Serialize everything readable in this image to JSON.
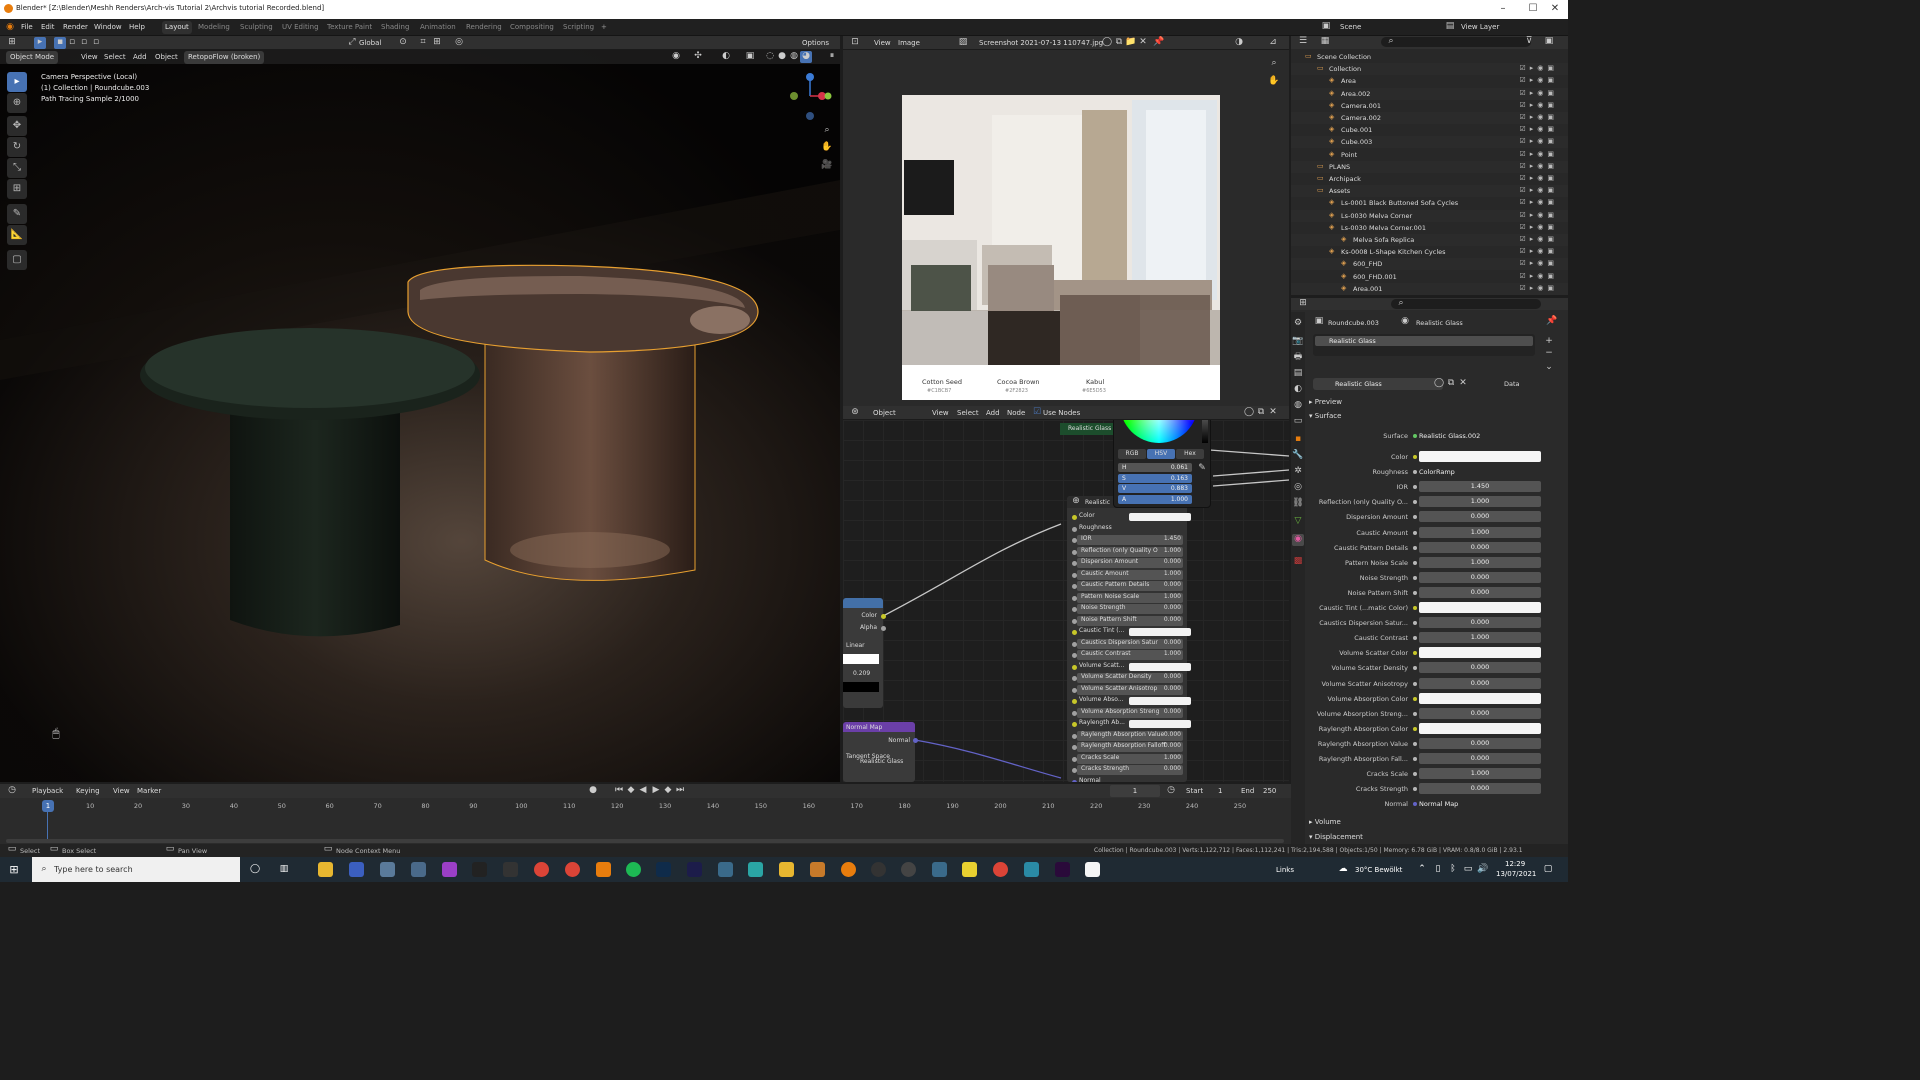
{
  "window": {
    "title": "Blender* [Z:\\Blender\\Meshh Renders\\Arch-vis Tutorial 2\\Archvis tutorial Recorded.blend]"
  },
  "menu": {
    "items": [
      "File",
      "Edit",
      "Render",
      "Window",
      "Help"
    ]
  },
  "workspaces": [
    "Layout",
    "Modeling",
    "Sculpting",
    "UV Editing",
    "Texture Paint",
    "Shading",
    "Animation",
    "Rendering",
    "Compositing",
    "Scripting"
  ],
  "scene": {
    "label": "Scene",
    "view_layer": "View Layer"
  },
  "viewport": {
    "mode": "Object Mode",
    "menus": [
      "View",
      "Select",
      "Add",
      "Object"
    ],
    "addon": "RetopoFlow (broken)",
    "transform": "Global",
    "options": "Options",
    "overlay_lines": [
      "Camera Perspective (Local)",
      "(1) Collection | Roundcube.003",
      "Path Tracing Sample 2/1000"
    ]
  },
  "image_editor": {
    "menus": [
      "View",
      "Image"
    ],
    "image_name": "Screenshot 2021-07-13 110747.jpg",
    "swatches": [
      {
        "name": "Cotton Seed",
        "code": "#C1BCB7",
        "color": "#c1bcb7"
      },
      {
        "name": "Cocoa Brown",
        "code": "#2F2823",
        "color": "#2f2823"
      },
      {
        "name": "Kabul",
        "code": "#6E5D53",
        "color": "#6e5d53"
      }
    ]
  },
  "color_picker": {
    "tabs": [
      "RGB",
      "HSV",
      "Hex"
    ],
    "active_tab": "HSV",
    "fields": [
      {
        "label": "H",
        "value": "0.061"
      },
      {
        "label": "S",
        "value": "0.163"
      },
      {
        "label": "V",
        "value": "0.883"
      },
      {
        "label": "A",
        "value": "1.000"
      }
    ]
  },
  "node_editor": {
    "object_mode": "Object",
    "menus": [
      "View",
      "Select",
      "Add",
      "Node"
    ],
    "use_nodes": "Use Nodes",
    "group_frame_label": "Realistic Glass",
    "group_node_label": "Realistic",
    "rows": [
      {
        "label": "Color",
        "value": ""
      },
      {
        "label": "Roughness",
        "value": ""
      },
      {
        "label": "IOR",
        "value": "1.450"
      },
      {
        "label": "Reflection (only Quality O",
        "value": "1.000"
      },
      {
        "label": "Dispersion Amount",
        "value": "0.000"
      },
      {
        "label": "Caustic Amount",
        "value": "1.000"
      },
      {
        "label": "Caustic Pattern Details",
        "value": "0.000"
      },
      {
        "label": "Pattern Noise Scale",
        "value": "1.000"
      },
      {
        "label": "Noise Strength",
        "value": "0.000"
      },
      {
        "label": "Noise Pattern Shift",
        "value": "0.000"
      },
      {
        "label": "Caustic Tint (...",
        "value": ""
      },
      {
        "label": "Caustics Dispersion Satur",
        "value": "0.000"
      },
      {
        "label": "Caustic Contrast",
        "value": "1.000"
      },
      {
        "label": "Volume Scatt...",
        "value": ""
      },
      {
        "label": "Volume Scatter Density",
        "value": "0.000"
      },
      {
        "label": "Volume Scatter Anisotrop",
        "value": "0.000"
      },
      {
        "label": "Volume Abso...",
        "value": ""
      },
      {
        "label": "Volume Absorption Streng",
        "value": "0.000"
      },
      {
        "label": "Raylength Ab...",
        "value": ""
      },
      {
        "label": "Raylength Absorption Value",
        "value": "0.000"
      },
      {
        "label": "Raylength Absorption Falloff",
        "value": "0.000"
      },
      {
        "label": "Cracks Scale",
        "value": "1.000"
      },
      {
        "label": "Cracks Strength",
        "value": "0.000"
      },
      {
        "label": "Normal",
        "value": ""
      }
    ],
    "ramp": {
      "outputs": [
        "Color",
        "Alpha"
      ],
      "interp": "Linear",
      "pos": "0.209"
    },
    "normal_map": {
      "title": "Normal Map",
      "output": "Normal",
      "space": "Tangent Space",
      "overlay_label": "Realistic Glass"
    }
  },
  "outliner": {
    "rows": [
      {
        "name": "Scene Collection",
        "indent": 0
      },
      {
        "name": "Collection",
        "indent": 1
      },
      {
        "name": "Area",
        "indent": 2
      },
      {
        "name": "Area.002",
        "indent": 2
      },
      {
        "name": "Camera.001",
        "indent": 2
      },
      {
        "name": "Camera.002",
        "indent": 2
      },
      {
        "name": "Cube.001",
        "indent": 2
      },
      {
        "name": "Cube.003",
        "indent": 2
      },
      {
        "name": "Point",
        "indent": 2
      },
      {
        "name": "PLANS",
        "indent": 1
      },
      {
        "name": "Archipack",
        "indent": 1
      },
      {
        "name": "Assets",
        "indent": 1
      },
      {
        "name": "Ls-0001 Black Buttoned Sofa Cycles",
        "indent": 2
      },
      {
        "name": "Ls-0030 Melva Corner",
        "indent": 2
      },
      {
        "name": "Ls-0030 Melva Corner.001",
        "indent": 2
      },
      {
        "name": "Melva Sofa Replica",
        "indent": 3
      },
      {
        "name": "Ks-0008 L-Shape Kitchen Cycles",
        "indent": 2
      },
      {
        "name": "600_FHD",
        "indent": 3
      },
      {
        "name": "600_FHD.001",
        "indent": 3
      },
      {
        "name": "Area.001",
        "indent": 3
      }
    ]
  },
  "properties": {
    "object": "Roundcube.003",
    "material": "Realistic Glass",
    "slot": "Realistic Glass",
    "data_label": "Data",
    "panels": {
      "preview": "Preview",
      "surface": "Surface",
      "volume": "Volume",
      "displacement": "Displacement"
    },
    "surface_label": "Surface",
    "surface_value": "Realistic Glass.002",
    "rows": [
      {
        "label": "Color",
        "value": "",
        "kind": "white",
        "dot": "y"
      },
      {
        "label": "Roughness",
        "value": "ColorRamp",
        "kind": "link",
        "dot": "g"
      },
      {
        "label": "IOR",
        "value": "1.450",
        "kind": "num",
        "dot": "g"
      },
      {
        "label": "Reflection (only Quality O...",
        "value": "1.000",
        "kind": "num",
        "dot": "g"
      },
      {
        "label": "Dispersion Amount",
        "value": "0.000",
        "kind": "num",
        "dot": "g"
      },
      {
        "label": "Caustic Amount",
        "value": "1.000",
        "kind": "num",
        "dot": "g"
      },
      {
        "label": "Caustic Pattern Details",
        "value": "0.000",
        "kind": "num",
        "dot": "g"
      },
      {
        "label": "Pattern Noise Scale",
        "value": "1.000",
        "kind": "num",
        "dot": "g"
      },
      {
        "label": "Noise Strength",
        "value": "0.000",
        "kind": "num",
        "dot": "g"
      },
      {
        "label": "Noise Pattern Shift",
        "value": "0.000",
        "kind": "num",
        "dot": "g"
      },
      {
        "label": "Caustic Tint (...matic Color)",
        "value": "",
        "kind": "white",
        "dot": "y"
      },
      {
        "label": "Caustics Dispersion Satur...",
        "value": "0.000",
        "kind": "num",
        "dot": "g"
      },
      {
        "label": "Caustic Contrast",
        "value": "1.000",
        "kind": "num",
        "dot": "g"
      },
      {
        "label": "Volume Scatter Color",
        "value": "",
        "kind": "white",
        "dot": "y"
      },
      {
        "label": "Volume Scatter Density",
        "value": "0.000",
        "kind": "num",
        "dot": "g"
      },
      {
        "label": "Volume Scatter Anisotropy",
        "value": "0.000",
        "kind": "num",
        "dot": "g"
      },
      {
        "label": "Volume Absorption Color",
        "value": "",
        "kind": "white",
        "dot": "y"
      },
      {
        "label": "Volume Absorption Streng...",
        "value": "0.000",
        "kind": "num",
        "dot": "g"
      },
      {
        "label": "Raylength Absorption Color",
        "value": "",
        "kind": "white",
        "dot": "y"
      },
      {
        "label": "Raylength Absorption Value",
        "value": "0.000",
        "kind": "num",
        "dot": "g"
      },
      {
        "label": "Raylength Absorption Fall...",
        "value": "0.000",
        "kind": "num",
        "dot": "g"
      },
      {
        "label": "Cracks Scale",
        "value": "1.000",
        "kind": "num",
        "dot": "g"
      },
      {
        "label": "Cracks Strength",
        "value": "0.000",
        "kind": "num",
        "dot": "g"
      },
      {
        "label": "Normal",
        "value": "Normal Map",
        "kind": "link",
        "dot": "b"
      }
    ]
  },
  "timeline": {
    "menus": [
      "Playback",
      "Keying",
      "View",
      "Marker"
    ],
    "current_frame": "1",
    "start_label": "Start",
    "start": "1",
    "end_label": "End",
    "end": "250",
    "ticks": [
      "1",
      "10",
      "20",
      "30",
      "40",
      "50",
      "60",
      "70",
      "80",
      "90",
      "100",
      "110",
      "120",
      "130",
      "140",
      "150",
      "160",
      "170",
      "180",
      "190",
      "200",
      "210",
      "220",
      "230",
      "240",
      "250"
    ]
  },
  "statusbar": {
    "left": [
      "Select",
      "Box Select",
      "Pan View",
      "Node Context Menu"
    ],
    "right": "Collection | Roundcube.003 | Verts:1,122,712 | Faces:1,112,241 | Tris:2,194,588 | Objects:1/50 | Memory: 6.78 GiB | VRAM: 0.8/8.0 GiB | 2.93.1"
  },
  "taskbar": {
    "search_placeholder": "Type here to search",
    "tray": {
      "lang": "Links",
      "weather": "30°C  Bewölkt",
      "time": "12:29",
      "date": "13/07/2021"
    }
  },
  "colors": {
    "accent": "#e87d0d",
    "selection_outline": "#e8a030",
    "active_tab": "#4772b3"
  }
}
